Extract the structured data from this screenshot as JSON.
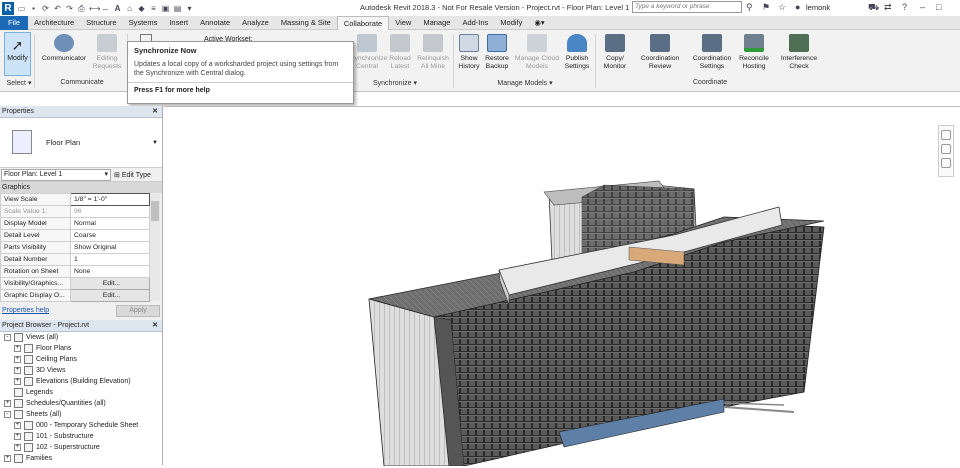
{
  "app": {
    "title": "Autodesk Revit 2018.3 - Not For Resale Version -    Project.rvt - Floor Plan: Level 1",
    "search_placeholder": "Type a keyword or phrase",
    "user": "lemonk"
  },
  "tabs": [
    "File",
    "Architecture",
    "Structure",
    "Systems",
    "Insert",
    "Annotate",
    "Analyze",
    "Massing & Site",
    "Collaborate",
    "View",
    "Manage",
    "Add-Ins",
    "Modify"
  ],
  "active_tab": "Collaborate",
  "ribbon": {
    "modify": "Modify",
    "select": "Select",
    "communicator": "Communicator",
    "editing_requests": "Editing Requests",
    "communicate_panel": "Communicate",
    "active_workset": "Active Workset:",
    "sync_panel": "Synchronize",
    "synchronize_central": "Synchronize Central",
    "reload_latest": "Reload Latest",
    "relinquish_all_mine": "Relinquish All Mine",
    "show_history": "Show History",
    "restore_backup": "Restore Backup",
    "manage_cloud_models": "Manage Cloud Models",
    "publish_settings": "Publish Settings",
    "manage_models_panel": "Manage Models",
    "copy_monitor": "Copy/ Monitor",
    "coordination_review": "Coordination Review",
    "coordination_settings": "Coordination Settings",
    "reconcile_hosting": "Reconcile Hosting",
    "interference_check": "Interference Check",
    "coordinate_panel": "Coordinate"
  },
  "tooltip": {
    "title": "Synchronize Now",
    "description": "Updates a local copy of a worksharded project using settings from the Synchronize with Central dialog.",
    "help": "Press F1 for more help"
  },
  "properties": {
    "header": "Properties",
    "type_name": "Floor Plan",
    "instance": "Floor Plan: Level 1",
    "edit_type": "Edit Type",
    "group": "Graphics",
    "rows": [
      {
        "k": "View Scale",
        "v": "1/8\" = 1'-0\""
      },
      {
        "k": "Scale Value    1:",
        "v": "96"
      },
      {
        "k": "Display Model",
        "v": "Normal"
      },
      {
        "k": "Detail Level",
        "v": "Coarse"
      },
      {
        "k": "Parts Visibility",
        "v": "Show Original"
      },
      {
        "k": "Detail Number",
        "v": "1"
      },
      {
        "k": "Rotation on Sheet",
        "v": "None"
      },
      {
        "k": "Visibility/Graphics...",
        "v": "Edit..."
      },
      {
        "k": "Graphic Display O...",
        "v": "Edit..."
      }
    ],
    "help_link": "Properties help",
    "apply": "Apply"
  },
  "browser": {
    "header": "Project Browser - Project.rvt",
    "items": [
      {
        "label": "Views (all)",
        "level": 0,
        "exp": "-"
      },
      {
        "label": "Floor Plans",
        "level": 1,
        "exp": "+"
      },
      {
        "label": "Ceiling Plans",
        "level": 1,
        "exp": "+"
      },
      {
        "label": "3D Views",
        "level": 1,
        "exp": "+"
      },
      {
        "label": "Elevations (Building Elevation)",
        "level": 1,
        "exp": "+"
      },
      {
        "label": "Legends",
        "level": 0,
        "exp": ""
      },
      {
        "label": "Schedules/Quantities (all)",
        "level": 0,
        "exp": "+"
      },
      {
        "label": "Sheets (all)",
        "level": 0,
        "exp": "-"
      },
      {
        "label": "000 - Temporary Schedule Sheet",
        "level": 1,
        "exp": "+"
      },
      {
        "label": "101 - Substructure",
        "level": 1,
        "exp": "+"
      },
      {
        "label": "102 - Superstructure",
        "level": 1,
        "exp": "+"
      },
      {
        "label": "Families",
        "level": 0,
        "exp": "+"
      }
    ]
  }
}
